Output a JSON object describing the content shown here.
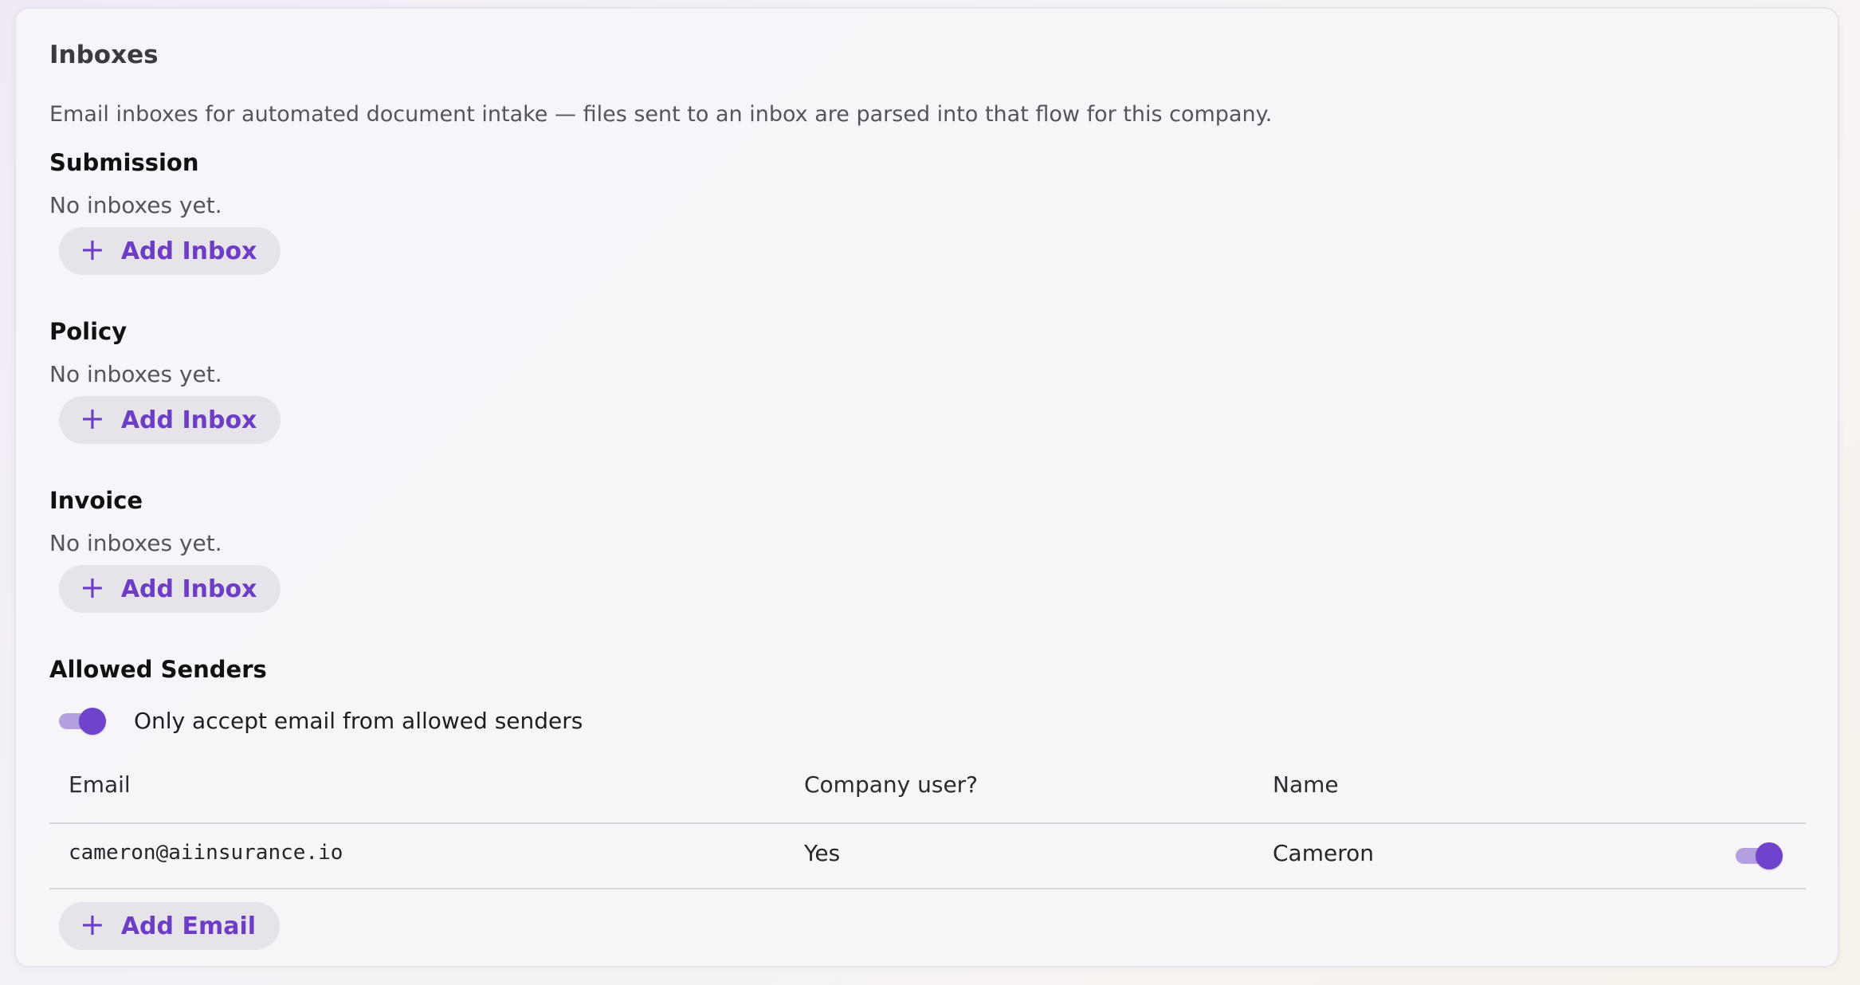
{
  "card": {
    "title": "Inboxes",
    "description": "Email inboxes for automated document intake — files sent to an inbox are parsed into that flow for this company."
  },
  "flows": [
    {
      "title": "Submission",
      "empty_text": "No inboxes yet.",
      "button_label": "Add Inbox"
    },
    {
      "title": "Policy",
      "empty_text": "No inboxes yet.",
      "button_label": "Add Inbox"
    },
    {
      "title": "Invoice",
      "empty_text": "No inboxes yet.",
      "button_label": "Add Inbox"
    }
  ],
  "allowed_senders": {
    "title": "Allowed Senders",
    "toggle_label": "Only accept email from allowed senders",
    "toggle_on": true,
    "columns": [
      "Email",
      "Company user?",
      "Name"
    ],
    "rows": [
      {
        "email": "cameron@aiinsurance.io",
        "company_user": "Yes",
        "name": "Cameron",
        "enabled": true
      }
    ],
    "add_button_label": "Add Email"
  },
  "icons": {
    "add": "plus-icon"
  },
  "colors": {
    "accent": "#6f43cc",
    "accent_text": "#6d3dc5",
    "toggle_track": "#b3a0e0",
    "button_bg": "#e6e3ea"
  }
}
